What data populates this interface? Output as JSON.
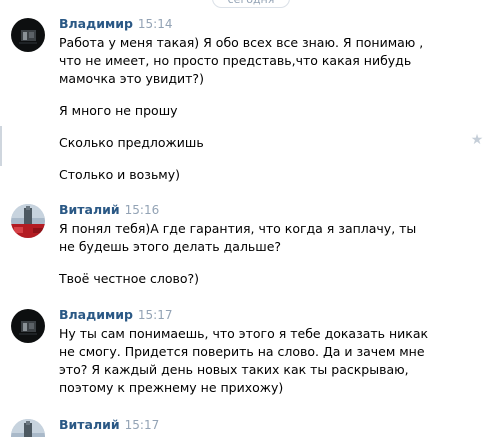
{
  "date_divider": "сегодня",
  "messages": [
    {
      "author": "Владимир",
      "time": "15:14",
      "paragraphs": [
        "Работа у меня такая) Я обо всех все знаю. Я понимаю , что не имеет, но просто представь,что какая нибудь мамочка это увидит?)",
        "Я много не прошу",
        "Сколько предложишь",
        "Столько и возьму)"
      ]
    },
    {
      "author": "Виталий",
      "time": "15:16",
      "paragraphs": [
        "Я понял тебя)А где гарантия, что когда я заплачу, ты не будешь этого делать дальше?",
        "Твоё честное слово?)"
      ]
    },
    {
      "author": "Владимир",
      "time": "15:17",
      "paragraphs": [
        "Ну ты сам понимаешь, что этого я тебе доказать никак не смогу. Придется поверить на слово. Да и зачем мне это? Я каждый день новых таких как ты раскрываю, поэтому к прежнему не прихожу)"
      ]
    },
    {
      "author": "Виталий",
      "time": "15:17",
      "paragraphs": []
    }
  ],
  "colors": {
    "author": "#2a5885",
    "time": "#93a3b5",
    "text": "#000000"
  },
  "icons": {
    "favorite": "star-icon"
  }
}
